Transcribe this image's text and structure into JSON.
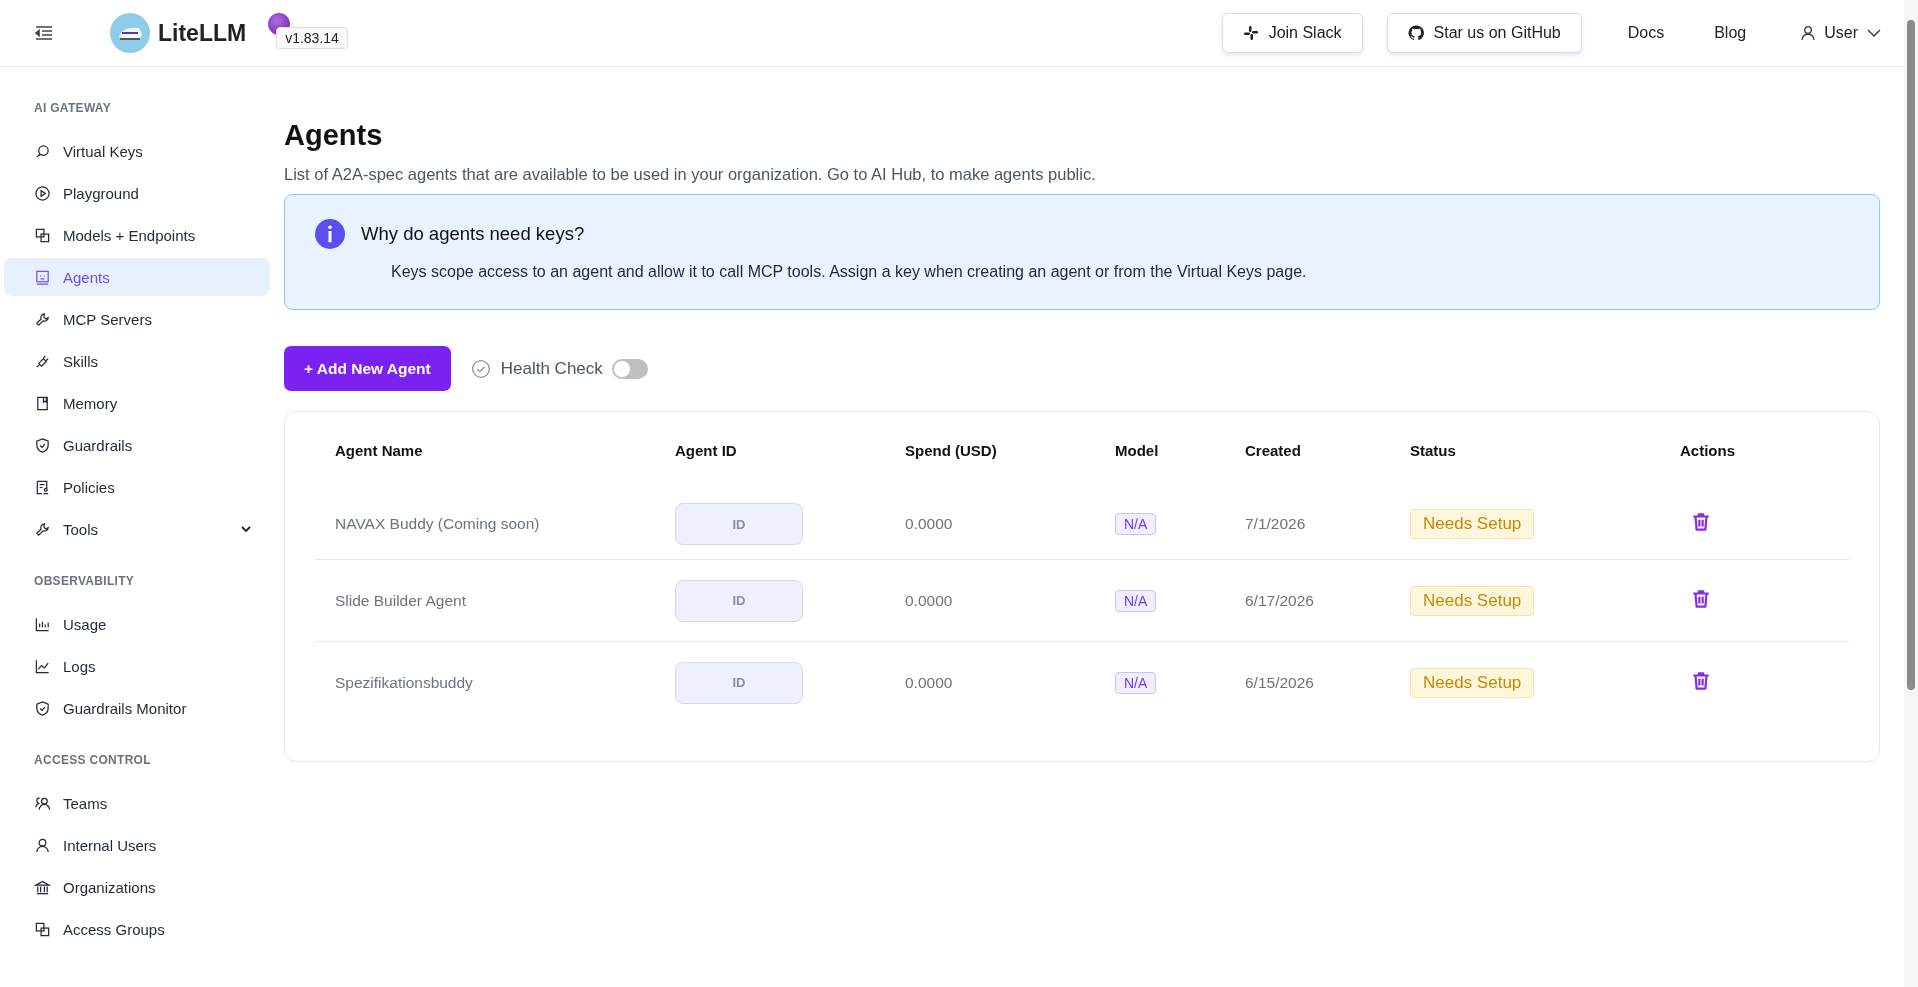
{
  "header": {
    "brand": "LiteLLM",
    "version": "v1.83.14",
    "links": [
      {
        "label": "Join Slack",
        "kind": "slack"
      },
      {
        "label": "Star us on GitHub",
        "kind": "github"
      },
      {
        "label": "Docs",
        "kind": "plain"
      },
      {
        "label": "Blog",
        "kind": "plain"
      }
    ],
    "user": "User"
  },
  "sidebar": {
    "sections": [
      {
        "title": "AI GATEWAY",
        "items": [
          {
            "label": "Virtual Keys",
            "selected": false
          },
          {
            "label": "Playground",
            "selected": false
          },
          {
            "label": "Models + Endpoints",
            "selected": false
          },
          {
            "label": "Agents",
            "selected": true
          },
          {
            "label": "MCP Servers",
            "selected": false
          },
          {
            "label": "Skills",
            "selected": false
          },
          {
            "label": "Memory",
            "selected": false
          },
          {
            "label": "Guardrails",
            "selected": false
          },
          {
            "label": "Policies",
            "selected": false
          },
          {
            "label": "Tools",
            "selected": false,
            "expanded": false
          }
        ]
      },
      {
        "title": "OBSERVABILITY",
        "items": [
          {
            "label": "Usage",
            "selected": false
          },
          {
            "label": "Logs",
            "selected": false
          },
          {
            "label": "Guardrails Monitor",
            "selected": false
          }
        ]
      },
      {
        "title": "ACCESS CONTROL",
        "items": [
          {
            "label": "Teams",
            "selected": false
          },
          {
            "label": "Internal Users",
            "selected": false
          },
          {
            "label": "Organizations",
            "selected": false
          },
          {
            "label": "Access Groups",
            "selected": false
          }
        ]
      }
    ]
  },
  "page": {
    "title": "Agents",
    "subtitle": "List of A2A-spec agents that are available to be used in your organization. Go to AI Hub, to make agents public.",
    "info": {
      "title": "Why do agents need keys?",
      "text": "Keys scope access to an agent and allow it to call MCP tools. Assign a key when creating an agent or from the Virtual Keys page."
    },
    "add_button": "+ Add New Agent",
    "health_check": {
      "label": "Health Check",
      "on": false
    }
  },
  "table": {
    "columns": [
      "Agent Name",
      "Agent ID",
      "Spend (USD)",
      "Model",
      "Created",
      "Status",
      "Actions"
    ],
    "rows": [
      {
        "name": "NAVAX Buddy (Coming soon)",
        "id": "ID",
        "spend": "0.0000",
        "model": "N/A",
        "created": "7/1/2026",
        "status": "Needs Setup"
      },
      {
        "name": "Slide Builder Agent",
        "id": "ID",
        "spend": "0.0000",
        "model": "N/A",
        "created": "6/17/2026",
        "status": "Needs Setup"
      },
      {
        "name": "Spezifikationsbuddy",
        "id": "ID",
        "spend": "0.0000",
        "model": "N/A",
        "created": "6/15/2026",
        "status": "Needs Setup"
      }
    ]
  }
}
